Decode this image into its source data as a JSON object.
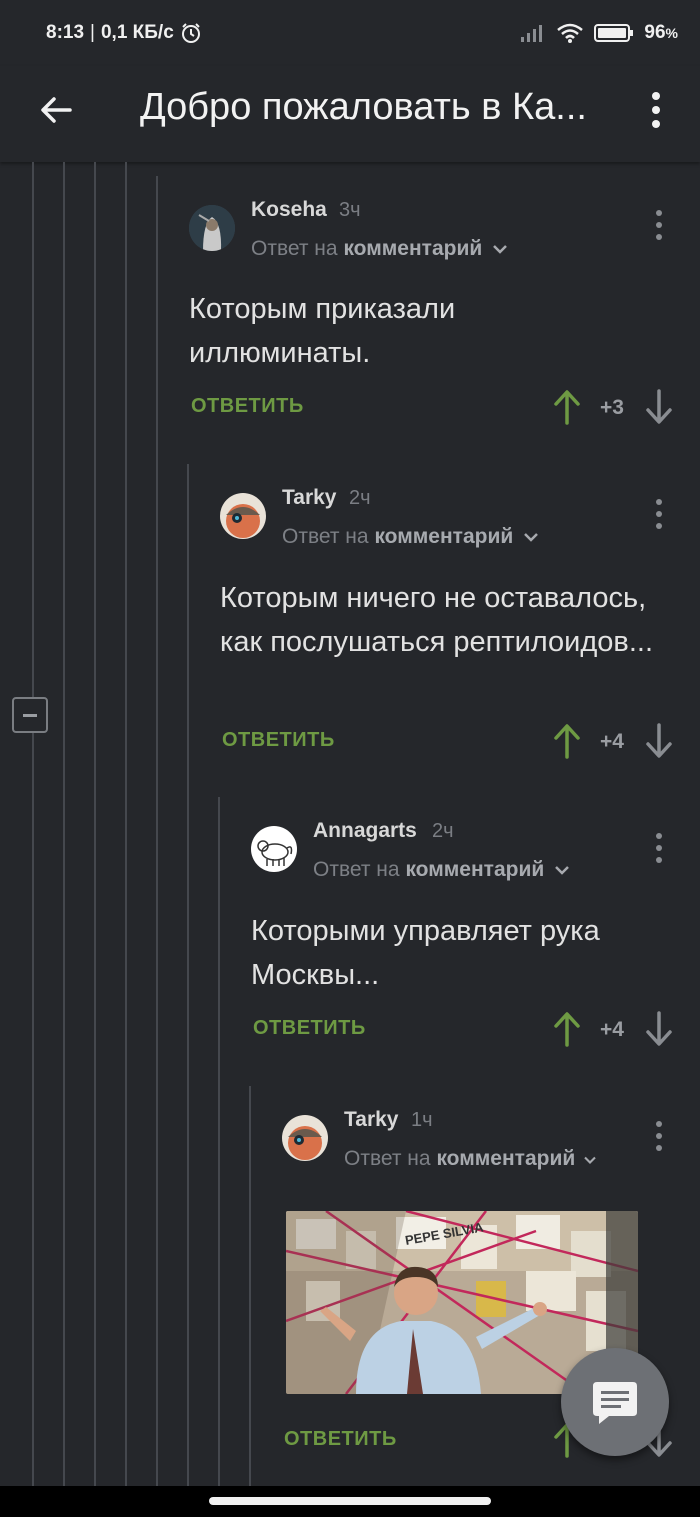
{
  "status_bar": {
    "time": "8:13",
    "speed": "0,1 КБ/с",
    "battery": "96",
    "battery_unit": "%"
  },
  "header": {
    "title": "Добро пожаловать в Ка..."
  },
  "comments": [
    {
      "author": "Koseha",
      "time": "3ч",
      "reply_prefix": "Ответ на",
      "reply_target": "комментарий",
      "text": "Которым приказали иллюминаты.",
      "reply_label": "ОТВЕТИТЬ",
      "score": "+3"
    },
    {
      "author": "Tarky",
      "time": "2ч",
      "reply_prefix": "Ответ на",
      "reply_target": "комментарий",
      "text": "Которым ничего не оставалось, как послушаться рептилоидов...",
      "reply_label": "ОТВЕТИТЬ",
      "score": "+4"
    },
    {
      "author": "Annagarts",
      "time": "2ч",
      "reply_prefix": "Ответ на",
      "reply_target": "комментарий",
      "text": "Которыми управляет рука Москвы...",
      "reply_label": "ОТВЕТИТЬ",
      "score": "+4"
    },
    {
      "author": "Tarky",
      "time": "1ч",
      "reply_prefix": "Ответ на",
      "reply_target": "комментарий",
      "text": "",
      "reply_label": "ОТВЕТИТЬ",
      "score": "",
      "image_text": "PEPE SILVIA"
    }
  ],
  "colors": {
    "background": "#25272b",
    "accent_green": "#6e9a43",
    "text": "#e2e2e2",
    "muted": "#7b7e84"
  }
}
